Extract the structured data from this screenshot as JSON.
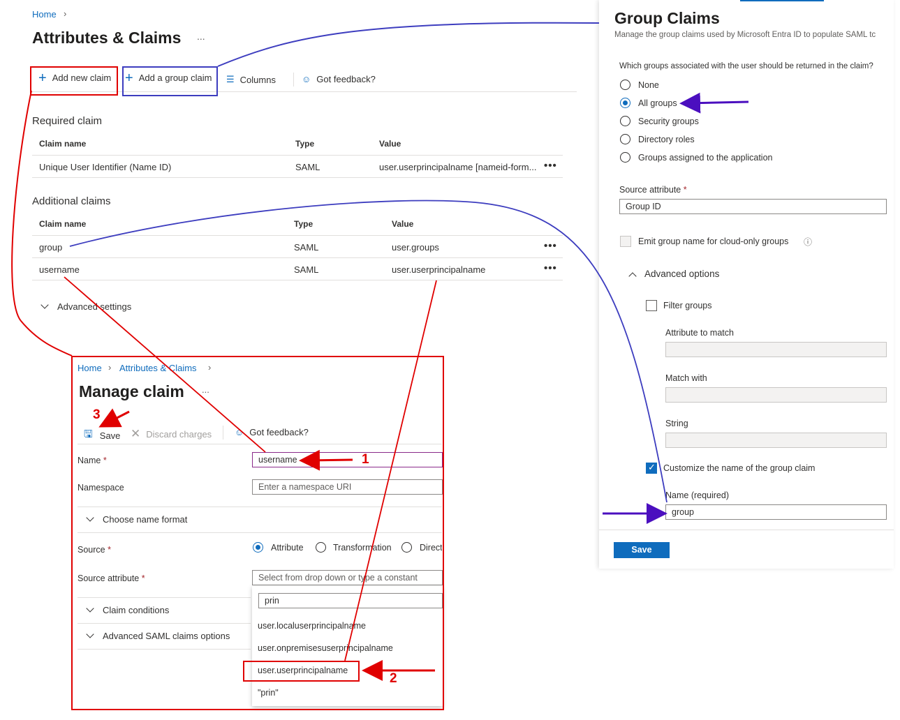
{
  "main": {
    "breadcrumb_home": "Home",
    "title": "Attributes & Claims",
    "more": "...",
    "toolbar": {
      "add_new_claim": "Add new claim",
      "add_group_claim": "Add a group claim",
      "columns": "Columns",
      "feedback": "Got feedback?"
    },
    "required_section": "Required claim",
    "additional_section": "Additional claims",
    "columns": {
      "claim_name": "Claim name",
      "type": "Type",
      "value": "Value"
    },
    "required_rows": [
      {
        "name": "Unique User Identifier (Name ID)",
        "type": "SAML",
        "value": "user.userprincipalname [nameid-form..."
      }
    ],
    "additional_rows": [
      {
        "name": "group",
        "type": "SAML",
        "value": "user.groups"
      },
      {
        "name": "username",
        "type": "SAML",
        "value": "user.userprincipalname"
      }
    ],
    "row_more": "•••",
    "advanced_settings": "Advanced settings"
  },
  "manage": {
    "breadcrumb": [
      "Home",
      "Attributes & Claims"
    ],
    "title": "Manage claim",
    "more": "...",
    "save": "Save",
    "discard": "Discard charges",
    "feedback": "Got feedback?",
    "name_label": "Name",
    "name_value": "username",
    "namespace_label": "Namespace",
    "namespace_placeholder": "Enter a namespace URI",
    "choose_format": "Choose name format",
    "source_label": "Source",
    "source_options": [
      "Attribute",
      "Transformation",
      "Direct"
    ],
    "source_attr_label": "Source attribute",
    "source_attr_placeholder": "Select from drop down or type a constant",
    "search_value": "prin",
    "dropdown_items": [
      "user.localuserprincipalname",
      "user.onpremisesuserprincipalname",
      "user.userprincipalname",
      "\"prin\""
    ],
    "claim_conditions": "Claim conditions",
    "advanced_saml": "Advanced SAML claims options",
    "required_mark": "*"
  },
  "group_panel": {
    "title": "Group Claims",
    "subtitle": "Manage the group claims used by Microsoft Entra ID to populate SAML tc",
    "question": "Which groups associated with the user should be returned in the claim?",
    "options": [
      "None",
      "All groups",
      "Security groups",
      "Directory roles",
      "Groups assigned to the application"
    ],
    "selected": "All groups",
    "source_attr_label": "Source attribute",
    "source_attr_value": "Group ID",
    "emit_label": "Emit group name for cloud-only groups",
    "advanced": "Advanced options",
    "filter_groups": "Filter groups",
    "attr_match": "Attribute to match",
    "match_with": "Match with",
    "string": "String",
    "customize": "Customize the name of the group claim",
    "name_required": "Name (required)",
    "name_value": "group",
    "save": "Save",
    "required_mark": "*"
  },
  "annotations": {
    "n1": "1",
    "n2": "2",
    "n3": "3"
  },
  "colors": {
    "accent": "#0f6cbd",
    "annotation_red": "#e00000",
    "annotation_blue": "#3d3dbf",
    "arrow_purple": "#4b0fbf"
  }
}
